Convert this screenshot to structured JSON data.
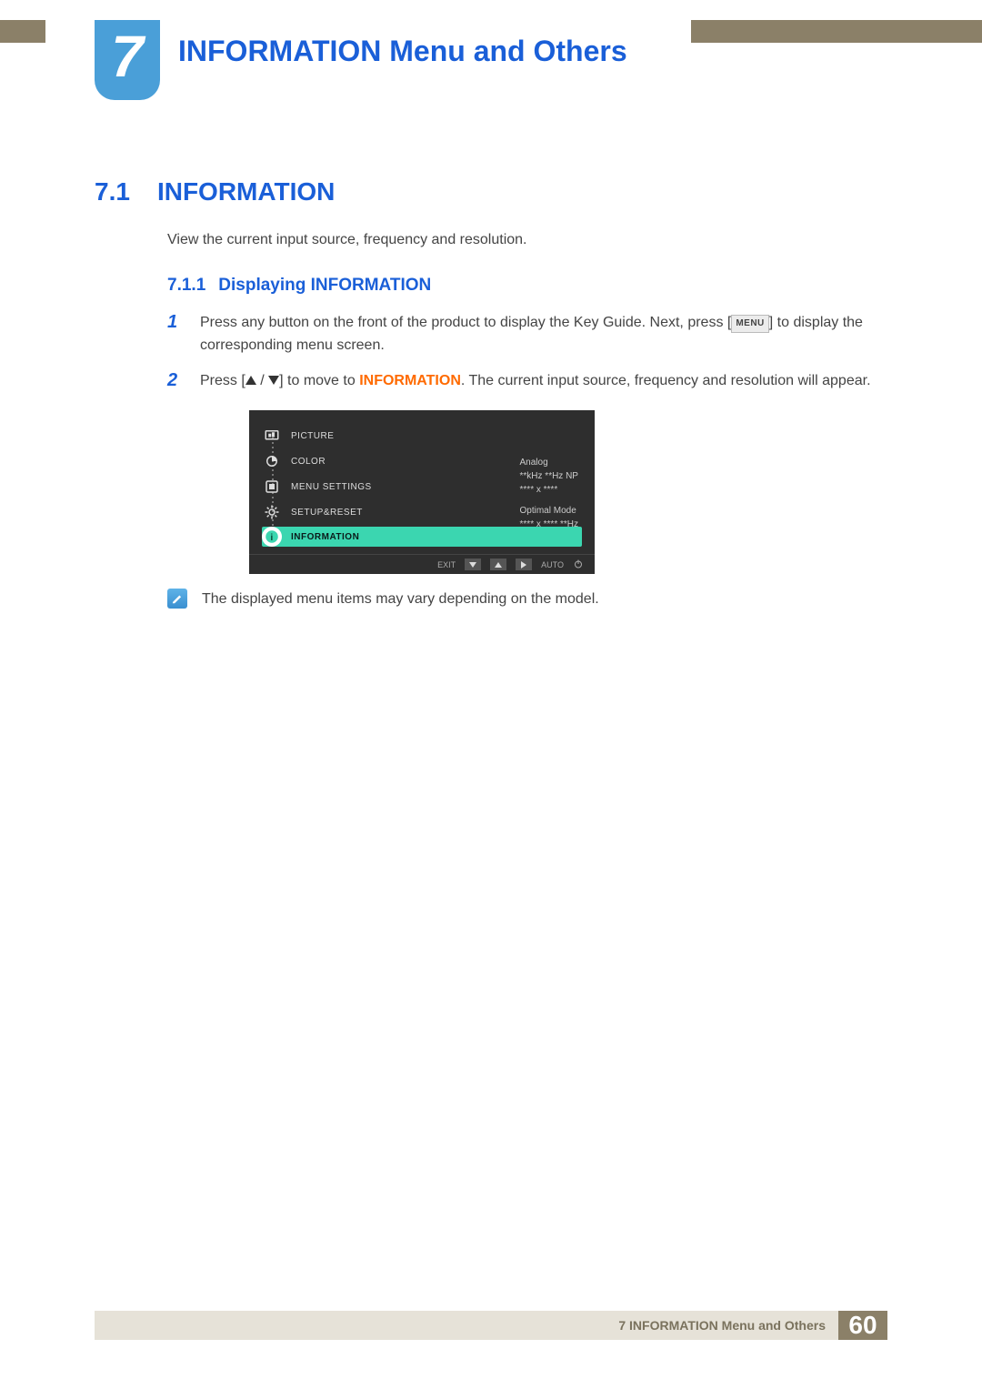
{
  "chapter": {
    "number": "7",
    "title": "INFORMATION Menu and Others"
  },
  "section": {
    "number": "7.1",
    "title": "INFORMATION",
    "intro": "View the current input source, frequency and resolution."
  },
  "subsection": {
    "number": "7.1.1",
    "title": "Displaying INFORMATION"
  },
  "steps": {
    "s1_num": "1",
    "s1a": "Press any button on the front of the product to display the Key Guide. Next, press [",
    "s1_menu": "MENU",
    "s1b": "] to display the corresponding menu screen.",
    "s2_num": "2",
    "s2a": "Press [",
    "s2b": "] to move to ",
    "s2_info": "INFORMATION",
    "s2c": ". The current input source, frequency and resolution will appear."
  },
  "osd": {
    "items": {
      "picture": "PICTURE",
      "color": "COLOR",
      "menu": "MENU SETTINGS",
      "setup": "SETUP&RESET",
      "information": "INFORMATION"
    },
    "panel": {
      "l1": "Analog",
      "l2": "**kHz **Hz NP",
      "l3": "**** x ****",
      "l4": "Optimal Mode",
      "l5": "**** x ****  **Hz"
    },
    "bottom": {
      "exit": "EXIT",
      "auto": "AUTO"
    }
  },
  "note": "The displayed menu items may vary depending on the model.",
  "footer": {
    "label": "7 INFORMATION Menu and Others",
    "page": "60"
  }
}
